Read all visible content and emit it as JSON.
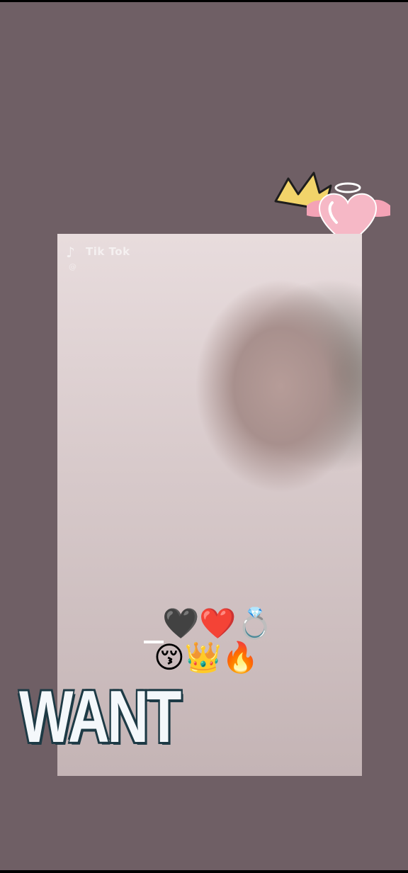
{
  "status_bar": {},
  "stickers": {
    "crown_heart": "crown-angel-heart-sticker"
  },
  "photo": {
    "watermark_app": "Tik Tok",
    "watermark_user": "@"
  },
  "emojis": {
    "row1": "🖤❤️💍",
    "row2": "😚👑🔥"
  },
  "caption": {
    "text": "WANT"
  },
  "colors": {
    "background": "#6f5f65",
    "caption_fill": "#f4f8fb",
    "caption_outline": "#1d3a45"
  }
}
